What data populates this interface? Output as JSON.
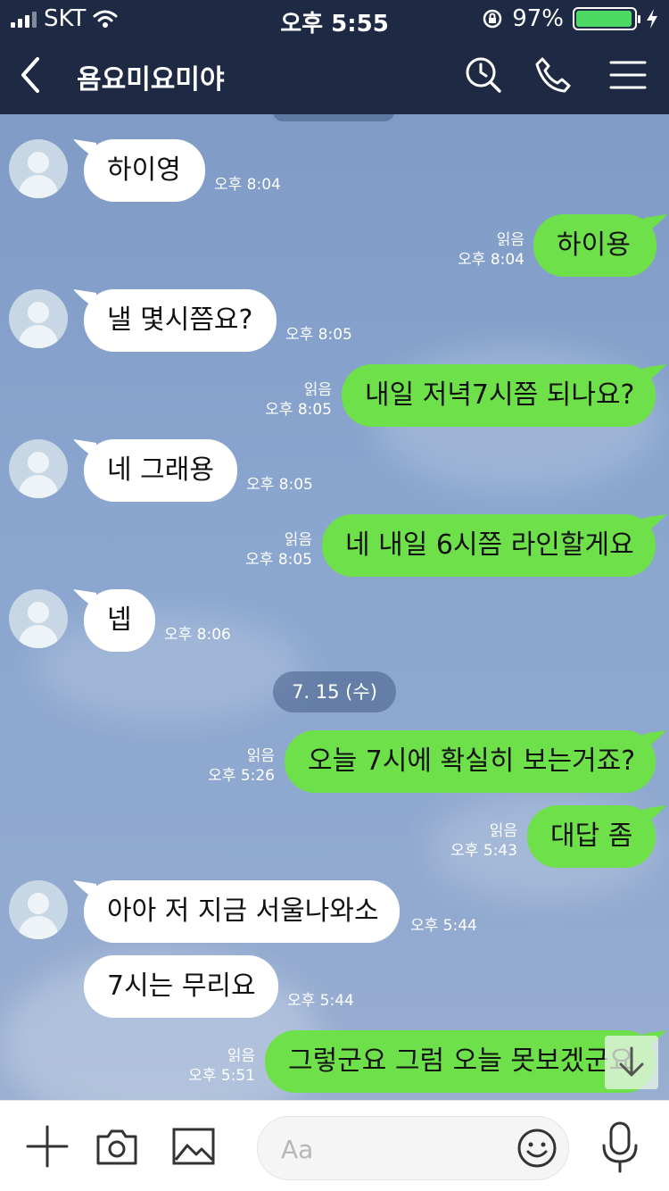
{
  "status_bar": {
    "carrier": "SKT",
    "time": "오후 5:55",
    "battery": "97%",
    "battery_level": 0.97
  },
  "header": {
    "title": "욤요미요미야"
  },
  "date_divider": "7. 15 (수)",
  "messages": [
    {
      "dir": "in",
      "text": "하이영",
      "time": "오후 8:04"
    },
    {
      "dir": "out",
      "text": "하이용",
      "time": "오후 8:04",
      "read": "읽음"
    },
    {
      "dir": "in",
      "text": "낼 몇시쯤요?",
      "time": "오후 8:05"
    },
    {
      "dir": "out",
      "text": "내일 저녁7시쯤 되나요?",
      "time": "오후 8:05",
      "read": "읽음"
    },
    {
      "dir": "in",
      "text": "네 그래용",
      "time": "오후 8:05"
    },
    {
      "dir": "out",
      "text": "네 내일 6시쯤 라인할게요",
      "time": "오후 8:05",
      "read": "읽음"
    },
    {
      "dir": "in",
      "text": "넵",
      "time": "오후 8:06"
    },
    {
      "dir": "out",
      "text": "오늘 7시에 확실히 보는거죠?",
      "time": "오후 5:26",
      "read": "읽음"
    },
    {
      "dir": "out",
      "text": "대답 좀",
      "time": "오후 5:43",
      "read": "읽음"
    },
    {
      "dir": "in",
      "text": "아아 저 지금 서울나와소",
      "time": "오후 5:44"
    },
    {
      "dir": "in",
      "text": "7시는 무리요",
      "time": "오후 5:44"
    },
    {
      "dir": "out",
      "text": "그렇군요 그럼 오늘 못보겠군요",
      "time": "오후 5:51",
      "read": "읽음"
    }
  ],
  "input": {
    "placeholder": "Aa"
  },
  "icons": {
    "status": [
      "signal-icon",
      "wifi-icon",
      "rotation-lock-icon",
      "battery-icon",
      "charging-icon"
    ],
    "header": [
      "back-icon",
      "search-icon",
      "call-icon",
      "menu-icon"
    ],
    "bottom": [
      "plus-icon",
      "camera-icon",
      "image-icon",
      "emoji-icon",
      "mic-icon"
    ]
  },
  "colors": {
    "header_bg": "#1e2a44",
    "outgoing_bubble": "#6ee04a",
    "incoming_bubble": "#ffffff",
    "chat_bg": "#8aa3c9"
  }
}
